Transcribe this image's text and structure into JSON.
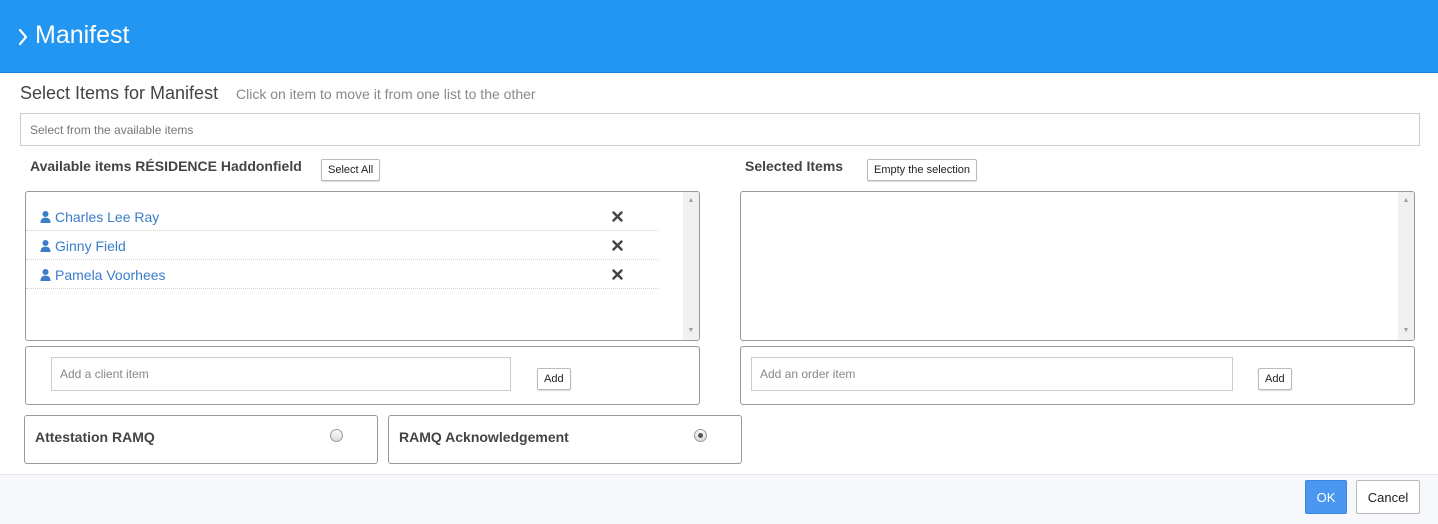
{
  "header": {
    "title": "Manifest",
    "icon": "chevron-right-icon"
  },
  "section": {
    "title": "Select Items for Manifest",
    "hint": "Click on item to move it from one list to the other"
  },
  "search": {
    "placeholder": "Select from the available items",
    "value": ""
  },
  "available": {
    "label": "Available items RÉSIDENCE Haddonfield",
    "select_all_label": "Select All",
    "items": [
      {
        "name": "Charles Lee Ray",
        "icon": "user-icon",
        "remove_icon": "close-icon"
      },
      {
        "name": "Ginny Field",
        "icon": "user-icon",
        "remove_icon": "close-icon"
      },
      {
        "name": "Pamela Voorhees",
        "icon": "user-icon",
        "remove_icon": "close-icon"
      }
    ],
    "add_placeholder": "Add a client item",
    "add_label": "Add"
  },
  "selected": {
    "label": "Selected Items",
    "empty_label": "Empty the selection",
    "items": [],
    "add_placeholder": "Add an order item",
    "add_label": "Add"
  },
  "options": [
    {
      "label": "Attestation RAMQ",
      "checked": false
    },
    {
      "label": "RAMQ Acknowledgement",
      "checked": true
    }
  ],
  "footer": {
    "ok_label": "OK",
    "cancel_label": "Cancel"
  },
  "colors": {
    "header_bg": "#2296f0",
    "link": "#3a7dc9",
    "ok_bg": "#4a97f2"
  }
}
